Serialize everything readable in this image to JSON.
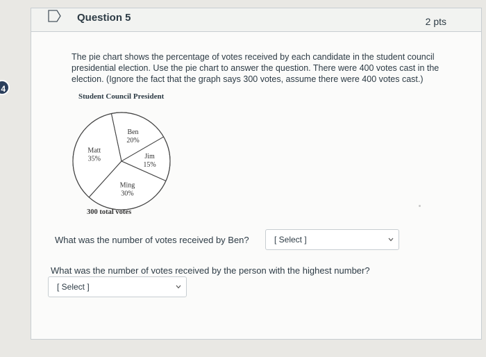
{
  "badge": "4",
  "question": {
    "title": "Question 5",
    "points": "2 pts",
    "text": "The pie chart shows the percentage of votes received by each candidate in the student council presidential election. Use the pie chart to answer the question. There were 400 votes cast in the election. (Ignore the fact that the graph says 300 votes, assume there were 400 votes cast.)"
  },
  "chart_data": {
    "type": "pie",
    "title": "Student Council President",
    "slices": [
      {
        "label": "Ben",
        "pct_label": "20%",
        "value": 20
      },
      {
        "label": "Jim",
        "pct_label": "15%",
        "value": 15
      },
      {
        "label": "Ming",
        "pct_label": "30%",
        "value": 30
      },
      {
        "label": "Matt",
        "pct_label": "35%",
        "value": 35
      }
    ],
    "footer": "300 total votes"
  },
  "sub_questions": [
    {
      "text": "What was the number of votes received by Ben?",
      "select": "[ Select ]"
    },
    {
      "text": "What was the number of votes received by the person with the highest number?",
      "select": "[ Select ]"
    }
  ]
}
